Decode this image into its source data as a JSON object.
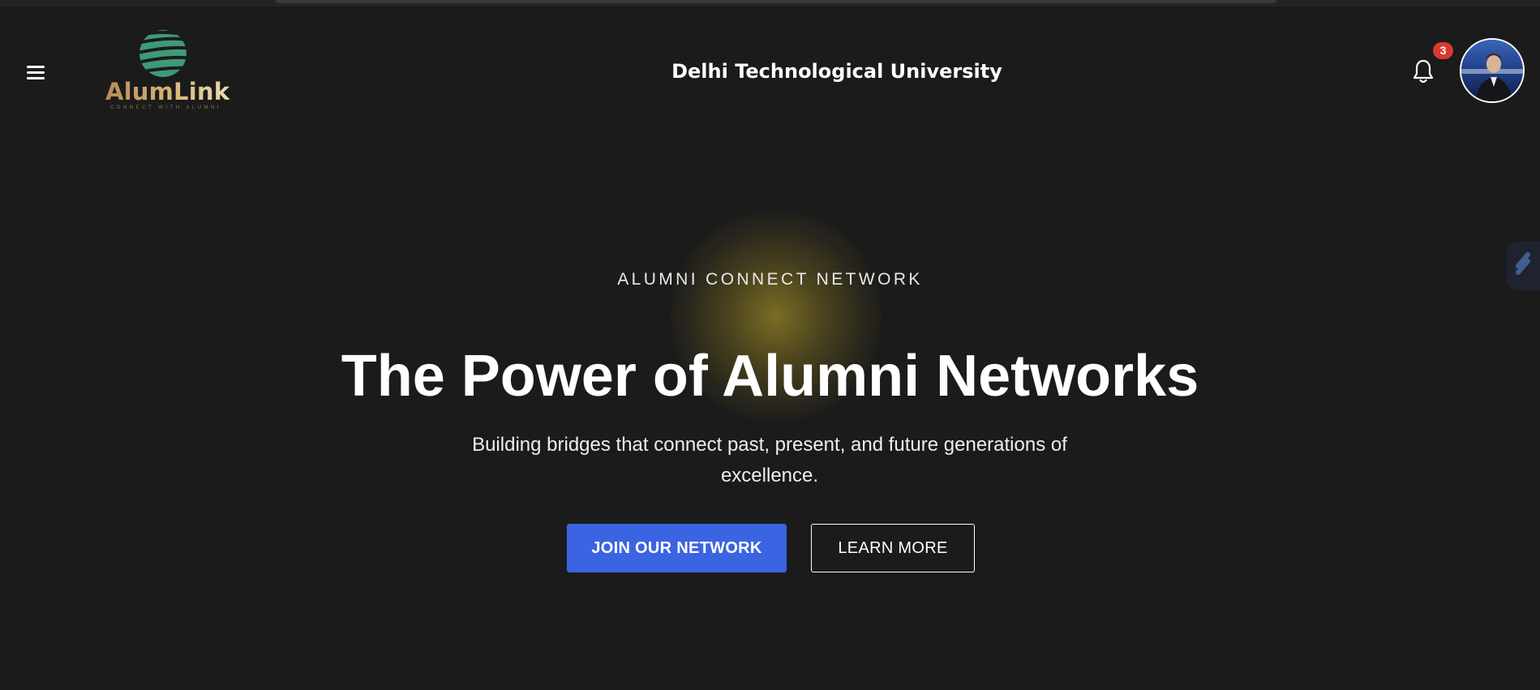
{
  "header": {
    "menu_icon": "hamburger-menu-icon",
    "logo": {
      "text": "AlumLink",
      "tagline": "CONNECT WITH ALUMNI",
      "globe_color": "#3f9a78",
      "text_color": "#c9a36a"
    },
    "university_name": "Delhi Technological University",
    "notifications": {
      "icon": "bell-icon",
      "count": "3",
      "badge_color": "#d93a2f"
    },
    "avatar_icon": "user-avatar"
  },
  "side_widget_icon": "lightning-icon",
  "hero": {
    "eyebrow": "ALUMNI CONNECT NETWORK",
    "title": "The Power of Alumni Networks",
    "subtitle": "Building bridges that connect past, present, and future generations of excellence.",
    "primary_button": "JOIN OUR NETWORK",
    "secondary_button": "LEARN MORE",
    "primary_color": "#3b64e2",
    "glow_color": "#807226"
  },
  "colors": {
    "background": "#1b1b1b",
    "text": "#ffffff"
  }
}
